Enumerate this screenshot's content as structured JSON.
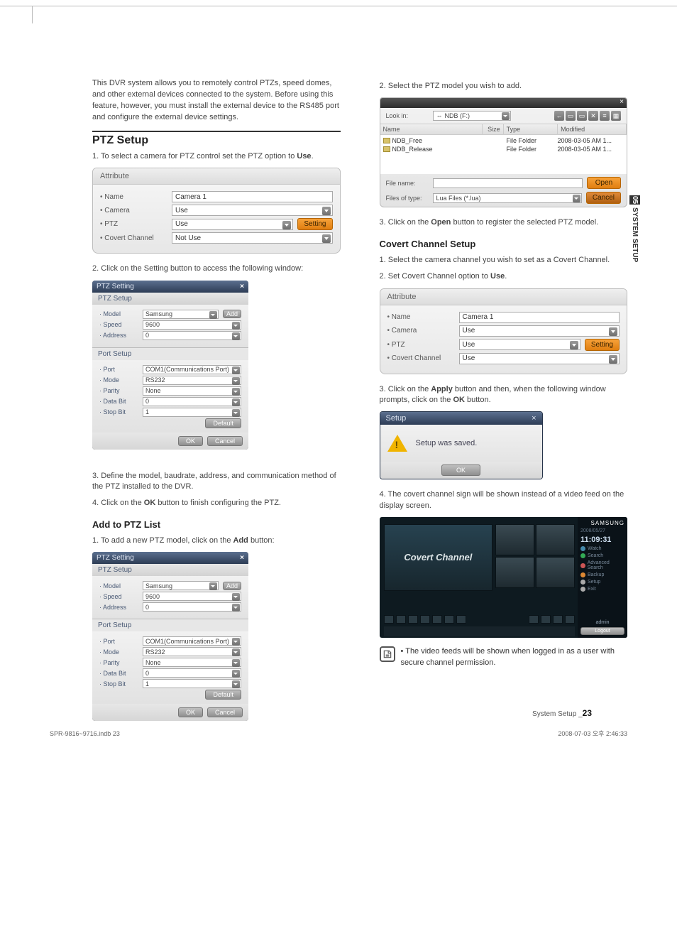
{
  "intro": "This DVR system allows you to remotely control PTZs, speed domes, and other external devices connected to the system. Before using this feature, however, you must install the external device to the RS485 port and configure the external device settings.",
  "section_ptz_setup": "PTZ Setup",
  "ptz_step1": "1.  To select a camera for PTZ control set the PTZ option to ",
  "ptz_step1_bold": "Use",
  "ptz_step1_end": ".",
  "attr_title": "Attribute",
  "attr": {
    "labels": {
      "name": "Name",
      "camera": "Camera",
      "ptz": "PTZ",
      "covert": "Covert Channel"
    },
    "first": {
      "name_val": "Camera 1",
      "camera_val": "Use",
      "ptz_val": "Use",
      "covert_val": "Not Use",
      "setting_btn": "Setting"
    }
  },
  "ptz_step2": "2.  Click on the Setting button to access the following window:",
  "ptz_dialog": {
    "title": "PTZ Setting",
    "sub": "PTZ Setup",
    "model_l": "Model",
    "model_v": "Samsung",
    "speed_l": "Speed",
    "speed_v": "9600",
    "address_l": "Address",
    "address_v": "0",
    "add_btn": "Add",
    "port_sub": "Port Setup",
    "port_l": "Port",
    "port_v": "COM1(Communications Port)",
    "mode_l": "Mode",
    "mode_v": "RS232",
    "parity_l": "Parity",
    "parity_v": "None",
    "data_l": "Data Bit",
    "data_v": "0",
    "stop_l": "Stop Bit",
    "stop_v": "1",
    "default_btn": "Default",
    "ok_btn": "OK",
    "cancel_btn": "Cancel"
  },
  "ptz_step3": "3.  Define the model, baudrate, address, and communication method of the PTZ installed to the DVR.",
  "ptz_step4a": "4. Click on the ",
  "ptz_step4b": "OK",
  "ptz_step4c": " button to finish configuring the PTZ.",
  "section_add_ptz": "Add to PTZ List",
  "addptz_step1a": "1. To add a new PTZ model, click on the ",
  "addptz_step1b": "Add",
  "addptz_step1c": " button:",
  "right_step2": "2. Select the PTZ model you wish to add.",
  "file": {
    "lookin_l": "Look in:",
    "lookin_v": "NDB (F:)",
    "hdr_name": "Name",
    "hdr_size": "Size",
    "hdr_type": "Type",
    "hdr_mod": "Modified",
    "rows": [
      {
        "n": "NDB_Free",
        "t": "File Folder",
        "m": "2008-03-05 AM 1..."
      },
      {
        "n": "NDB_Release",
        "t": "File Folder",
        "m": "2008-03-05 AM 1..."
      }
    ],
    "filename_l": "File name:",
    "filename_v": "",
    "filetype_l": "Files of type:",
    "filetype_v": "Lua Files (*.lua)",
    "open_btn": "Open",
    "cancel_btn": "Cancel"
  },
  "right_step3a": "3. Click on the ",
  "right_step3b": "Open",
  "right_step3c": " button to register the selected PTZ model.",
  "section_covert": "Covert Channel Setup",
  "cov_step1": "1. Select the camera channel you wish to set as a Covert Channel.",
  "cov_step2a": "2. Set Covert Channel option to ",
  "cov_step2b": "Use",
  "cov_step2c": ".",
  "attr2": {
    "name_val": "Camera 1",
    "camera_val": "Use",
    "ptz_val": "Use",
    "covert_val": "Use",
    "setting_btn": "Setting"
  },
  "cov_step3a": "3. Click on the ",
  "cov_step3b": "Apply",
  "cov_step3c": " button and then, when the following window prompts, click on the ",
  "cov_step3d": "OK",
  "cov_step3e": " button.",
  "setup_dialog": {
    "title": "Setup",
    "msg": "Setup was saved.",
    "ok": "OK"
  },
  "cov_step4": "4. The covert channel sign will be shown instead of a video feed on the display screen.",
  "covert_label": "Covert Channel",
  "cs": {
    "brand": "SAMSUNG",
    "date": "2008/05/27",
    "time": "11:09:31",
    "menu": [
      "Watch",
      "Search",
      "Advanced Search",
      "Backup",
      "Setup",
      "Exit"
    ],
    "user": "admin",
    "logout": "Logout"
  },
  "note_bullet": "•",
  "note_text": "The video feeds will be shown when logged in as a user with secure channel permission.",
  "side_num": "05",
  "side_text": "SYSTEM SETUP",
  "page_label_a": "System Setup _",
  "page_label_b": "23",
  "footer_left": "SPR-9816~9716.indb   23",
  "footer_right": "2008-07-03   오후 2:46:33"
}
